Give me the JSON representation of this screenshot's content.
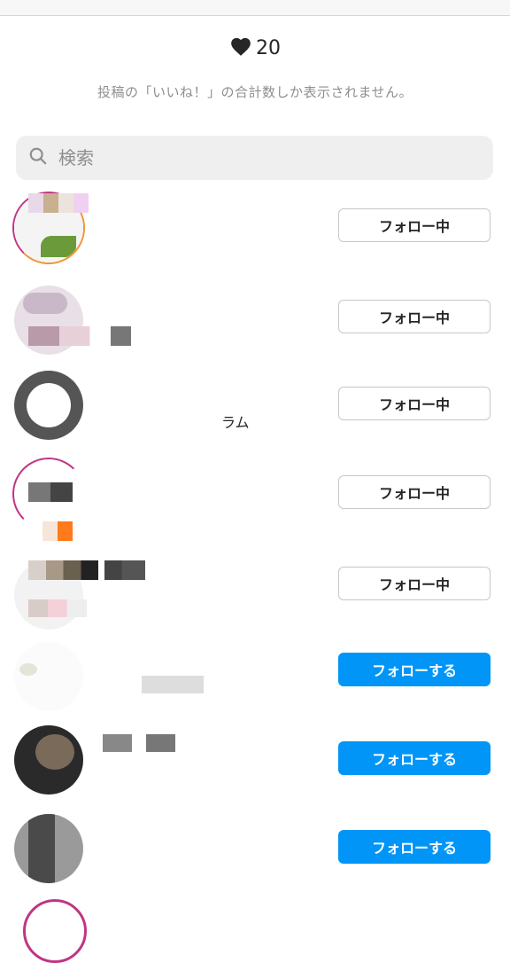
{
  "header": {
    "like_count": "20",
    "note": "投稿の「いいね！」の合計数しか表示されません。"
  },
  "search": {
    "placeholder": "検索"
  },
  "rows": [
    {
      "button_label": "フォロー中",
      "state": "following"
    },
    {
      "button_label": "フォロー中",
      "state": "following"
    },
    {
      "button_label": "フォロー中",
      "state": "following",
      "subtitle": "ラム"
    },
    {
      "button_label": "フォロー中",
      "state": "following"
    },
    {
      "button_label": "フォロー中",
      "state": "following"
    },
    {
      "button_label": "フォローする",
      "state": "follow"
    },
    {
      "button_label": "フォローする",
      "state": "follow"
    },
    {
      "button_label": "フォローする",
      "state": "follow"
    }
  ],
  "colors": {
    "accent": "#0095f6",
    "muted": "#8e8e8e",
    "search_bg": "#efefef"
  }
}
